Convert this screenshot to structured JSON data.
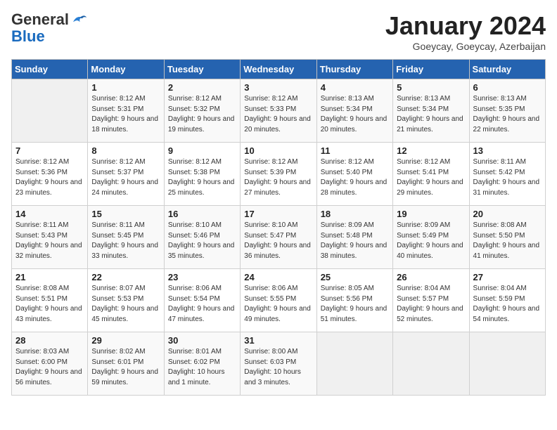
{
  "logo": {
    "line1": "General",
    "line2": "Blue"
  },
  "title": "January 2024",
  "location": "Goeycay, Goeycay, Azerbaijan",
  "days_of_week": [
    "Sunday",
    "Monday",
    "Tuesday",
    "Wednesday",
    "Thursday",
    "Friday",
    "Saturday"
  ],
  "weeks": [
    [
      {
        "day": "",
        "sunrise": "",
        "sunset": "",
        "daylight": ""
      },
      {
        "day": "1",
        "sunrise": "Sunrise: 8:12 AM",
        "sunset": "Sunset: 5:31 PM",
        "daylight": "Daylight: 9 hours and 18 minutes."
      },
      {
        "day": "2",
        "sunrise": "Sunrise: 8:12 AM",
        "sunset": "Sunset: 5:32 PM",
        "daylight": "Daylight: 9 hours and 19 minutes."
      },
      {
        "day": "3",
        "sunrise": "Sunrise: 8:12 AM",
        "sunset": "Sunset: 5:33 PM",
        "daylight": "Daylight: 9 hours and 20 minutes."
      },
      {
        "day": "4",
        "sunrise": "Sunrise: 8:13 AM",
        "sunset": "Sunset: 5:34 PM",
        "daylight": "Daylight: 9 hours and 20 minutes."
      },
      {
        "day": "5",
        "sunrise": "Sunrise: 8:13 AM",
        "sunset": "Sunset: 5:34 PM",
        "daylight": "Daylight: 9 hours and 21 minutes."
      },
      {
        "day": "6",
        "sunrise": "Sunrise: 8:13 AM",
        "sunset": "Sunset: 5:35 PM",
        "daylight": "Daylight: 9 hours and 22 minutes."
      }
    ],
    [
      {
        "day": "7",
        "sunrise": "Sunrise: 8:12 AM",
        "sunset": "Sunset: 5:36 PM",
        "daylight": "Daylight: 9 hours and 23 minutes."
      },
      {
        "day": "8",
        "sunrise": "Sunrise: 8:12 AM",
        "sunset": "Sunset: 5:37 PM",
        "daylight": "Daylight: 9 hours and 24 minutes."
      },
      {
        "day": "9",
        "sunrise": "Sunrise: 8:12 AM",
        "sunset": "Sunset: 5:38 PM",
        "daylight": "Daylight: 9 hours and 25 minutes."
      },
      {
        "day": "10",
        "sunrise": "Sunrise: 8:12 AM",
        "sunset": "Sunset: 5:39 PM",
        "daylight": "Daylight: 9 hours and 27 minutes."
      },
      {
        "day": "11",
        "sunrise": "Sunrise: 8:12 AM",
        "sunset": "Sunset: 5:40 PM",
        "daylight": "Daylight: 9 hours and 28 minutes."
      },
      {
        "day": "12",
        "sunrise": "Sunrise: 8:12 AM",
        "sunset": "Sunset: 5:41 PM",
        "daylight": "Daylight: 9 hours and 29 minutes."
      },
      {
        "day": "13",
        "sunrise": "Sunrise: 8:11 AM",
        "sunset": "Sunset: 5:42 PM",
        "daylight": "Daylight: 9 hours and 31 minutes."
      }
    ],
    [
      {
        "day": "14",
        "sunrise": "Sunrise: 8:11 AM",
        "sunset": "Sunset: 5:43 PM",
        "daylight": "Daylight: 9 hours and 32 minutes."
      },
      {
        "day": "15",
        "sunrise": "Sunrise: 8:11 AM",
        "sunset": "Sunset: 5:45 PM",
        "daylight": "Daylight: 9 hours and 33 minutes."
      },
      {
        "day": "16",
        "sunrise": "Sunrise: 8:10 AM",
        "sunset": "Sunset: 5:46 PM",
        "daylight": "Daylight: 9 hours and 35 minutes."
      },
      {
        "day": "17",
        "sunrise": "Sunrise: 8:10 AM",
        "sunset": "Sunset: 5:47 PM",
        "daylight": "Daylight: 9 hours and 36 minutes."
      },
      {
        "day": "18",
        "sunrise": "Sunrise: 8:09 AM",
        "sunset": "Sunset: 5:48 PM",
        "daylight": "Daylight: 9 hours and 38 minutes."
      },
      {
        "day": "19",
        "sunrise": "Sunrise: 8:09 AM",
        "sunset": "Sunset: 5:49 PM",
        "daylight": "Daylight: 9 hours and 40 minutes."
      },
      {
        "day": "20",
        "sunrise": "Sunrise: 8:08 AM",
        "sunset": "Sunset: 5:50 PM",
        "daylight": "Daylight: 9 hours and 41 minutes."
      }
    ],
    [
      {
        "day": "21",
        "sunrise": "Sunrise: 8:08 AM",
        "sunset": "Sunset: 5:51 PM",
        "daylight": "Daylight: 9 hours and 43 minutes."
      },
      {
        "day": "22",
        "sunrise": "Sunrise: 8:07 AM",
        "sunset": "Sunset: 5:53 PM",
        "daylight": "Daylight: 9 hours and 45 minutes."
      },
      {
        "day": "23",
        "sunrise": "Sunrise: 8:06 AM",
        "sunset": "Sunset: 5:54 PM",
        "daylight": "Daylight: 9 hours and 47 minutes."
      },
      {
        "day": "24",
        "sunrise": "Sunrise: 8:06 AM",
        "sunset": "Sunset: 5:55 PM",
        "daylight": "Daylight: 9 hours and 49 minutes."
      },
      {
        "day": "25",
        "sunrise": "Sunrise: 8:05 AM",
        "sunset": "Sunset: 5:56 PM",
        "daylight": "Daylight: 9 hours and 51 minutes."
      },
      {
        "day": "26",
        "sunrise": "Sunrise: 8:04 AM",
        "sunset": "Sunset: 5:57 PM",
        "daylight": "Daylight: 9 hours and 52 minutes."
      },
      {
        "day": "27",
        "sunrise": "Sunrise: 8:04 AM",
        "sunset": "Sunset: 5:59 PM",
        "daylight": "Daylight: 9 hours and 54 minutes."
      }
    ],
    [
      {
        "day": "28",
        "sunrise": "Sunrise: 8:03 AM",
        "sunset": "Sunset: 6:00 PM",
        "daylight": "Daylight: 9 hours and 56 minutes."
      },
      {
        "day": "29",
        "sunrise": "Sunrise: 8:02 AM",
        "sunset": "Sunset: 6:01 PM",
        "daylight": "Daylight: 9 hours and 59 minutes."
      },
      {
        "day": "30",
        "sunrise": "Sunrise: 8:01 AM",
        "sunset": "Sunset: 6:02 PM",
        "daylight": "Daylight: 10 hours and 1 minute."
      },
      {
        "day": "31",
        "sunrise": "Sunrise: 8:00 AM",
        "sunset": "Sunset: 6:03 PM",
        "daylight": "Daylight: 10 hours and 3 minutes."
      },
      {
        "day": "",
        "sunrise": "",
        "sunset": "",
        "daylight": ""
      },
      {
        "day": "",
        "sunrise": "",
        "sunset": "",
        "daylight": ""
      },
      {
        "day": "",
        "sunrise": "",
        "sunset": "",
        "daylight": ""
      }
    ]
  ]
}
